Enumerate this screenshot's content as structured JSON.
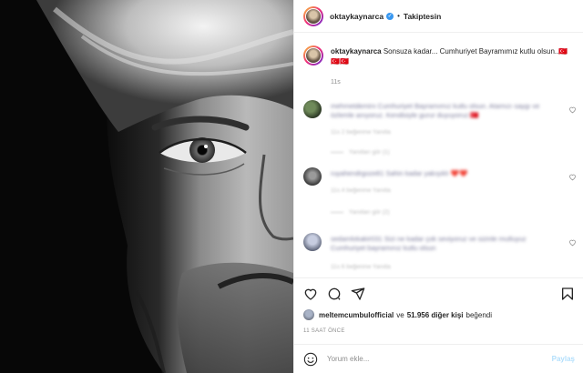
{
  "post": {
    "username": "oktaykaynarca",
    "follow_state": "Takiptesin",
    "caption_user": "oktaykaynarca",
    "caption_text": "Sonsuza kadar... Cumhuriyet Bayramımız kutlu olsun..🇹🇷🇹🇷🇹🇷",
    "caption_time": "11s"
  },
  "comments": [
    {
      "text_blurred": "mehmetdemirx Cumhuriyet Bayramımız kutlu olsun. Atamızı saygı ve özlemle anıyoruz. Kendisiyle gurur duyuyoruz 🇹🇷",
      "meta_blurred": "11s   2 beğenme   Yanıtla",
      "replies_blurred": "Yanıtları gör (1)"
    },
    {
      "text_blurred": "ruyahendrgoze81 Sahin kadar yakışıklı ❤️❤️",
      "meta_blurred": "11s   4 beğenme   Yanıtla",
      "replies_blurred": "Yanıtları gör (2)"
    },
    {
      "text_blurred": "sedamlokakir031 Sizi ne kadar çok seviyoruz ve sizinle mutluyuz Cumhuriyet bayramınız kutlu olsun",
      "meta_blurred": "11s   6 beğenme   Yanıtla",
      "replies_blurred": ""
    }
  ],
  "likes": {
    "liker": "meltemcumbulofficial",
    "connector": "ve",
    "count_text": "51.956 diğer kişi",
    "suffix": "beğendi"
  },
  "time_ago": "11 SAAT ÖNCE",
  "comment_box": {
    "placeholder": "Yorum ekle...",
    "post_label": "Paylaş"
  },
  "icons": {
    "like": "heart-icon",
    "comment": "comment-icon",
    "share": "share-icon",
    "save": "bookmark-icon",
    "emoji": "emoji-icon",
    "verified": "verified-badge-icon"
  },
  "colors": {
    "verified_blue": "#3897f0",
    "post_button_disabled": "#b2dffc",
    "muted_text": "#8e8e8e"
  }
}
